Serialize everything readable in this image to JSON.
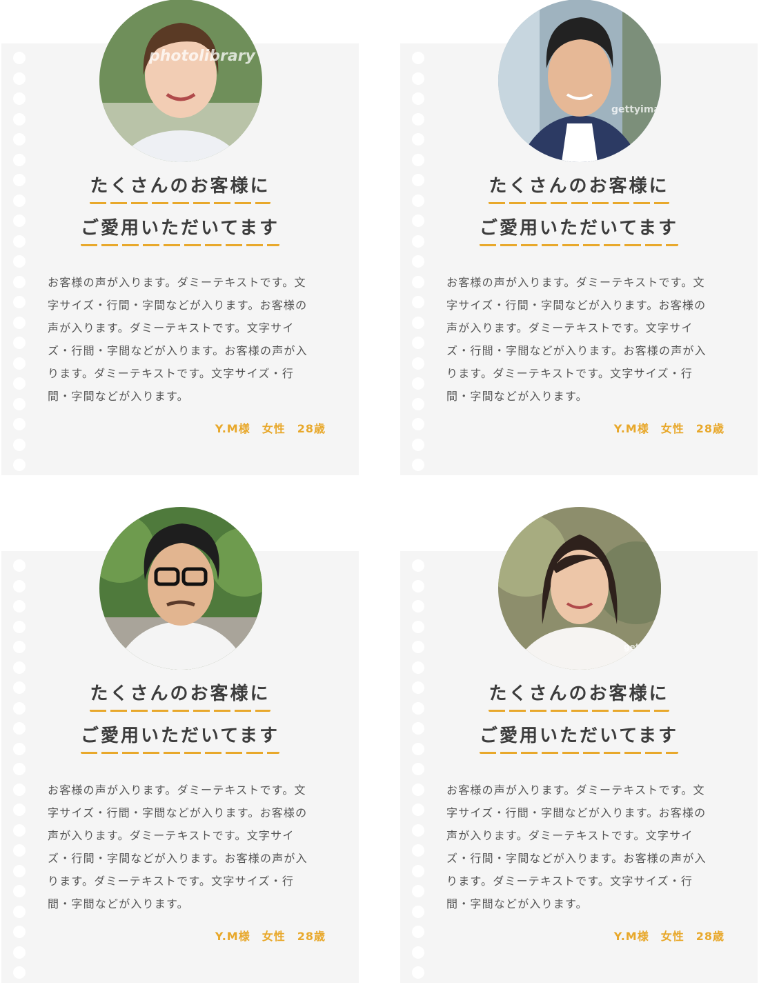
{
  "testimonials": [
    {
      "title_line1": "たくさんのお客様に",
      "title_line2": "ご愛用いただいてます",
      "body": "お客様の声が入ります。ダミーテキストです。文字サイズ・行間・字間などが入ります。お客様の声が入ります。ダミーテキストです。文字サイズ・行間・字間などが入ります。お客様の声が入ります。ダミーテキストです。文字サイズ・行間・字間などが入ります。",
      "signature": "Y.M様　女性　28歳",
      "watermark": "photolibrary"
    },
    {
      "title_line1": "たくさんのお客様に",
      "title_line2": "ご愛用いただいてます",
      "body": "お客様の声が入ります。ダミーテキストです。文字サイズ・行間・字間などが入ります。お客様の声が入ります。ダミーテキストです。文字サイズ・行間・字間などが入ります。お客様の声が入ります。ダミーテキストです。文字サイズ・行間・字間などが入ります。",
      "signature": "Y.M様　女性　28歳",
      "watermark": "gettyimages"
    },
    {
      "title_line1": "たくさんのお客様に",
      "title_line2": "ご愛用いただいてます",
      "body": "お客様の声が入ります。ダミーテキストです。文字サイズ・行間・字間などが入ります。お客様の声が入ります。ダミーテキストです。文字サイズ・行間・字間などが入ります。お客様の声が入ります。ダミーテキストです。文字サイズ・行間・字間などが入ります。",
      "signature": "Y.M様　女性　28歳",
      "watermark": ""
    },
    {
      "title_line1": "たくさんのお客様に",
      "title_line2": "ご愛用いただいてます",
      "body": "お客様の声が入ります。ダミーテキストです。文字サイズ・行間・字間などが入ります。お客様の声が入ります。ダミーテキストです。文字サイズ・行間・字間などが入ります。お客様の声が入ります。ダミーテキストです。文字サイズ・行間・字間などが入ります。",
      "signature": "Y.M様　女性　28歳",
      "watermark": "getty"
    }
  ],
  "colors": {
    "accent": "#e8a82b",
    "card_bg": "#f5f5f5",
    "text": "#555555",
    "heading": "#3c3c3c"
  }
}
